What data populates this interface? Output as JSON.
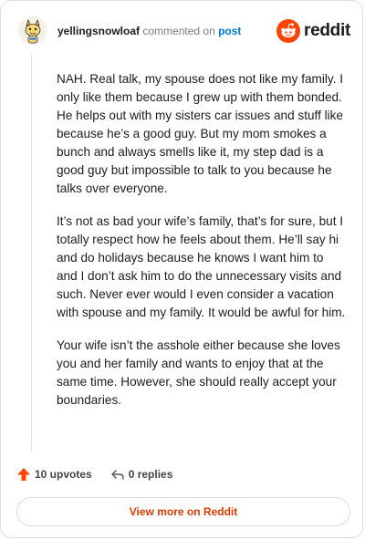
{
  "header": {
    "username": "yellingsnowloaf",
    "commented_on_text": "commented on",
    "post_link": "post",
    "brand": "reddit"
  },
  "comment": {
    "paragraphs": [
      "NAH. Real talk, my spouse does not like my family. I only like them because I grew up with them bonded. He helps out with my sisters car issues and stuff like because he’s a good guy. But my mom smokes a bunch and always smells like it, my step dad is a good guy but impossible to talk to you because he talks over everyone.",
      "It’s not as bad your wife’s family, that’s for sure, but I totally respect how he feels about them. He’ll say hi and do holidays because he knows I want him to and I don’t ask him to do the unnecessary visits and such. Never ever would I even consider a vacation with spouse and my family. It would be awful for him.",
      "Your wife isn’t the asshole either because she loves you and her family and wants to enjoy that at the same time. However, she should really accept your boundaries."
    ]
  },
  "actions": {
    "upvotes": "10 upvotes",
    "replies": "0 replies"
  },
  "footer": {
    "view_more": "View more on Reddit"
  },
  "colors": {
    "upvote": "#ff4500",
    "link": "#0079d3",
    "view_more": "#d93a00"
  },
  "icons": {
    "avatar": "snoo-avatar-icon",
    "logo": "reddit-logo-icon",
    "upvote": "upvote-arrow-icon",
    "reply": "reply-arrow-icon"
  }
}
